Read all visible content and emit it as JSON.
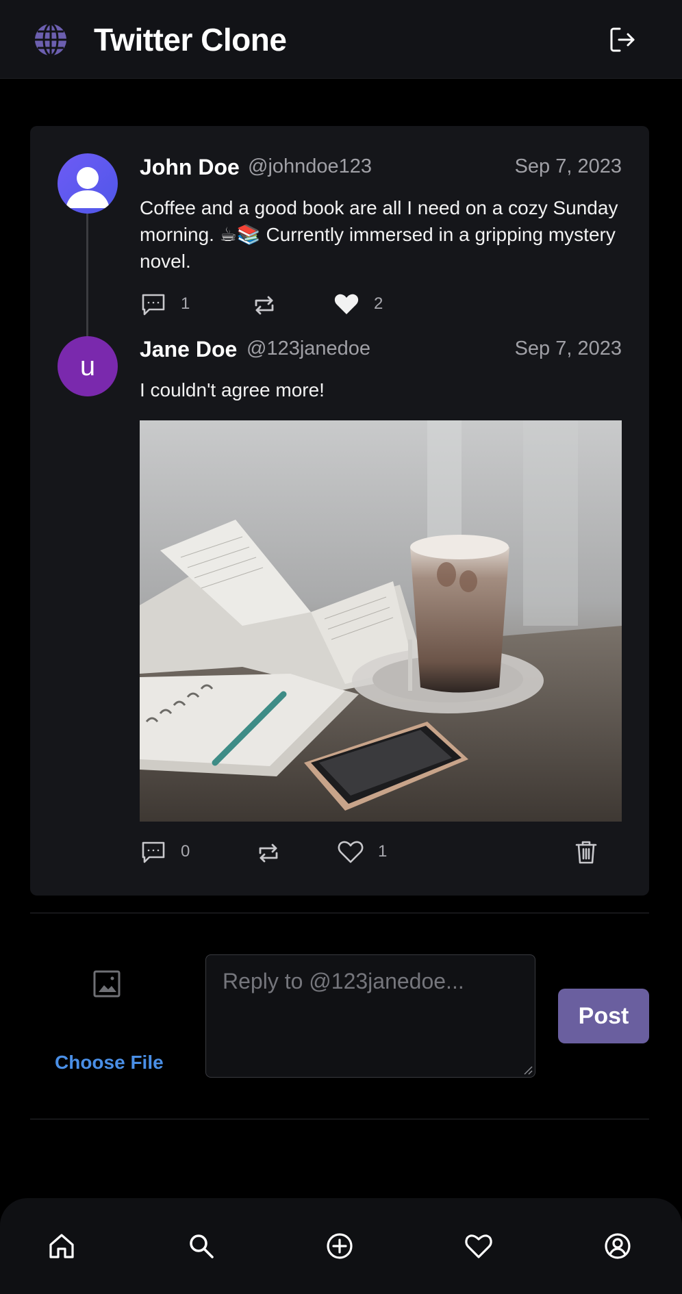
{
  "header": {
    "title": "Twitter Clone",
    "logo_icon": "globe-icon",
    "logout_icon": "logout-icon",
    "logo_color": "#6c5fb0"
  },
  "thread": [
    {
      "name": "John Doe",
      "handle": "@johndoe123",
      "date": "Sep 7, 2023",
      "text": "Coffee and a good book are all I need on a cozy Sunday morning. ☕📚 Currently immersed in a gripping mystery novel.",
      "avatar_icon": "default-user-avatar",
      "replies": "1",
      "likes": "2",
      "liked": true
    },
    {
      "name": "Jane Doe",
      "handle": "@123janedoe",
      "date": "Sep 7, 2023",
      "text": "I couldn't agree more!",
      "avatar_letter": "u",
      "replies": "0",
      "likes": "1",
      "liked": false,
      "image_icon": "coffee-book-photo",
      "delete_icon": "trash-icon"
    }
  ],
  "composer": {
    "placeholder": "Reply to @123janedoe...",
    "choose_file": "Choose File",
    "post_label": "Post",
    "accent_color": "#6a5f9f",
    "link_color": "#4a8fe6"
  },
  "bottom_nav": {
    "items": [
      "home-icon",
      "search-icon",
      "add-circle-icon",
      "heart-icon",
      "user-circle-icon"
    ]
  }
}
